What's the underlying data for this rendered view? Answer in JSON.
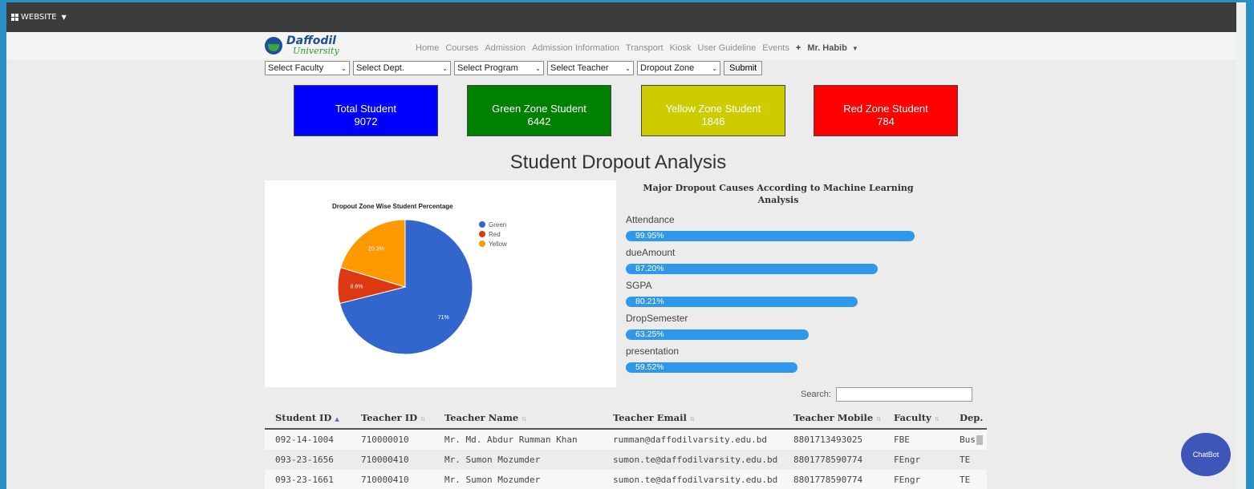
{
  "topbar": {
    "website_label": "WEBSITE"
  },
  "brand": {
    "name_line1": "Daffodil",
    "name_line2": "University"
  },
  "nav": {
    "items": [
      "Home",
      "Courses",
      "Admission",
      "Admission Information",
      "Transport",
      "Kiosk",
      "User Guideline",
      "Events"
    ],
    "plus": "+",
    "user": "Mr. Habib"
  },
  "filters": {
    "faculty": "Select Faculty",
    "dept": "Select Dept.",
    "program": "Select Program",
    "teacher": "Select Teacher",
    "zone": "Dropout Zone",
    "submit": "Submit"
  },
  "cards": [
    {
      "label": "Total Student",
      "value": "9072",
      "color": "#0000ff",
      "text_color": "#ffffff"
    },
    {
      "label": "Green Zone Student",
      "value": "6442",
      "color": "#008000",
      "text_color": "#ffffff"
    },
    {
      "label": "Yellow Zone Student",
      "value": "1846",
      "color": "#cccc00",
      "text_color": "#ffffff"
    },
    {
      "label": "Red Zone Student",
      "value": "784",
      "color": "#ff0000",
      "text_color": "#ffffff"
    }
  ],
  "heading": "Student Dropout Analysis",
  "chart_data": {
    "type": "pie",
    "title": "Dropout Zone Wise Student Percentage",
    "categories": [
      "Green",
      "Red",
      "Yellow"
    ],
    "values": [
      71,
      8.6,
      20.3
    ],
    "labels": [
      "71%",
      "8.6%",
      "20.3%"
    ],
    "colors": [
      "#3366cc",
      "#dc3912",
      "#ff9900"
    ],
    "legend": "right"
  },
  "causes": {
    "title": "Major Dropout Causes According to Machine Learning Analysis",
    "items": [
      {
        "name": "Attendance",
        "percent": 99.95,
        "label": "99.95%"
      },
      {
        "name": "dueAmount",
        "percent": 87.2,
        "label": "87.20%"
      },
      {
        "name": "SGPA",
        "percent": 80.21,
        "label": "80.21%"
      },
      {
        "name": "DropSemester",
        "percent": 63.25,
        "label": "63.25%"
      },
      {
        "name": "presentation",
        "percent": 59.52,
        "label": "59.52%"
      }
    ]
  },
  "search": {
    "label": "Search:",
    "value": ""
  },
  "table": {
    "headers": [
      "Student ID",
      "Teacher ID",
      "Teacher Name",
      "Teacher Email",
      "Teacher Mobile",
      "Faculty",
      "Dep."
    ],
    "rows": [
      [
        "092-14-1004",
        "710000010",
        "Mr. Md. Abdur Rumman Khan",
        "rumman@daffodilvarsity.edu.bd",
        "8801713493025",
        "FBE",
        "Bus"
      ],
      [
        "093-23-1656",
        "710000410",
        "Mr. Sumon Mozumder",
        "sumon.te@daffodilvarsity.edu.bd",
        "8801778590774",
        "FEngr",
        "TE"
      ],
      [
        "093-23-1661",
        "710000410",
        "Mr. Sumon Mozumder",
        "sumon.te@daffodilvarsity.edu.bd",
        "8801778590774",
        "FEngr",
        "TE"
      ]
    ]
  },
  "chatbot": "ChatBot"
}
